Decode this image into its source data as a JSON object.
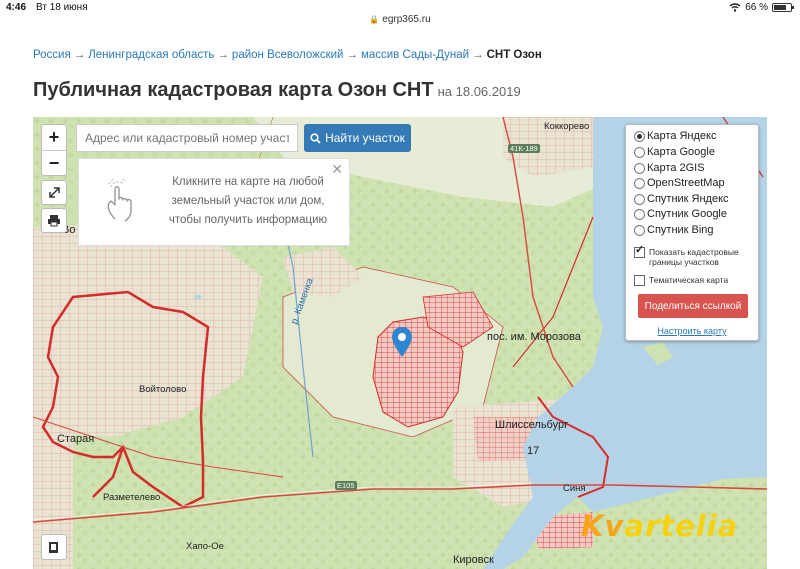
{
  "status_bar": {
    "time": "4:46",
    "date": "Вт 18 июня",
    "battery": "66 %"
  },
  "browser": {
    "url": "egrp365.ru"
  },
  "breadcrumb": {
    "items": [
      "Россия",
      "Ленинградская область",
      "район Всеволожский",
      "массив Сады-Дунай"
    ],
    "current": "СНТ Озон",
    "separator": "→"
  },
  "page": {
    "title": "Публичная кадастровая карта Озон СНТ",
    "date": "на 18.06.2019"
  },
  "map": {
    "zoom_in": "+",
    "zoom_out": "−",
    "search": {
      "placeholder": "Адрес или кадастровый номер участка",
      "button": "Найти участок"
    },
    "hint": {
      "text": "Кликните на карте на любой земельный участок или дом, чтобы получить информацию",
      "close": "✕"
    },
    "layers": {
      "options": [
        "Карта Яндекс",
        "Карта Google",
        "Карта 2GIS",
        "OpenStreetMap",
        "Спутник Яндекс",
        "Спутник Google",
        "Спутник Bing"
      ],
      "selected": "Карта Яндекс",
      "show_borders": "Показать кадастровые границы участков",
      "show_borders_checked": true,
      "thematic": "Тематическая карта",
      "thematic_checked": false,
      "share": "Поделиться ссылкой",
      "configure": "Настроить карту"
    },
    "labels": {
      "kokkorevo": "Коккорево",
      "road_41k": "41К-189",
      "v_prefix": "Во",
      "kamenka": "р. Каменка",
      "morozova": "пос. им. Морозова",
      "voitolovo": "Войтолово",
      "staraya": "Старая",
      "shlisselburg": "Шлиссельбург",
      "num17": "17",
      "e105": "E105",
      "razmetelevo": "Разметелево",
      "khapo_oe": "Хапо-Ое",
      "sinyavino": "Синя",
      "kirovsk": "Кировск"
    },
    "watermark": {
      "part1": "Kv",
      "part2": "artelia"
    },
    "colors": {
      "water": "#b5d3e7",
      "land": "#dfe8c8",
      "cadastral": "#e05a5a",
      "boundary": "#d42b2b",
      "accent": "#337ab7",
      "share": "#d9534f"
    }
  }
}
